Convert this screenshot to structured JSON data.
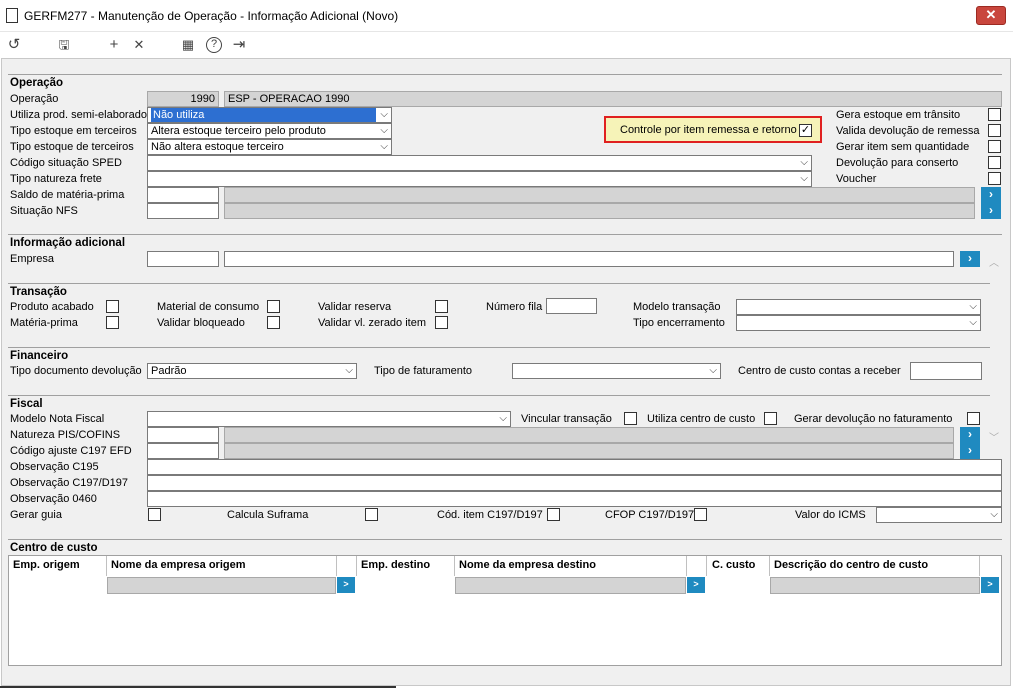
{
  "window": {
    "title": "GERFM277 - Manutenção de Operação - Informação Adicional (Novo)",
    "close_label": "✕"
  },
  "toolbar": {
    "undo": "↺",
    "save": "🖫",
    "add": "+",
    "remove": "✕",
    "calendar": "▦",
    "help": "?",
    "exit": "⇥"
  },
  "operacao": {
    "section": "Operação",
    "operacao_label": "Operação",
    "operacao_code": "1990",
    "operacao_desc": "ESP - OPERACAO 1990",
    "semi_label": "Utiliza prod. semi-elaborado",
    "semi_value": "Não utiliza",
    "tipo_estoque_label": "Tipo estoque em terceiros",
    "tipo_estoque_value": "Altera estoque terceiro pelo produto",
    "tipo_estoque_de_label": "Tipo estoque de terceiros",
    "tipo_estoque_de_value": "Não altera estoque terceiro",
    "sped_label": "Código situação SPED",
    "natureza_label": "Tipo natureza frete",
    "saldo_label": "Saldo de matéria-prima",
    "nfs_label": "Situação NFS",
    "controle_label": "Controle por item remessa e retorno",
    "gera_label": "Gera estoque em trânsito",
    "valida_label": "Valida devolução de remessa",
    "gerar_item_label": "Gerar item sem quantidade",
    "devolucao_label": "Devolução para conserto",
    "voucher_label": "Voucher"
  },
  "info": {
    "section": "Informação adicional",
    "empresa_label": "Empresa"
  },
  "transacao": {
    "section": "Transação",
    "produto_label": "Produto acabado",
    "materia_label": "Matéria-prima",
    "consumo_label": "Material de consumo",
    "bloqueado_label": "Validar bloqueado",
    "reserva_label": "Validar reserva",
    "zerado_label": "Validar vl. zerado item",
    "fila_label": "Número fila",
    "modelo_label": "Modelo transação",
    "encerramento_label": "Tipo encerramento"
  },
  "financeiro": {
    "section": "Financeiro",
    "tipo_doc_label": "Tipo documento devolução",
    "tipo_doc_value": "Padrão",
    "faturamento_label": "Tipo de faturamento",
    "centro_label": "Centro de custo contas a receber"
  },
  "fiscal": {
    "section": "Fiscal",
    "modelo_label": "Modelo Nota Fiscal",
    "vincular_label": "Vincular transação",
    "utiliza_label": "Utiliza centro de custo",
    "gerar_dev_label": "Gerar devolução no faturamento",
    "natureza_label": "Natureza PIS/COFINS",
    "ajuste_label": "Código ajuste C197 EFD",
    "obs_c195": "Observação C195",
    "obs_c197": "Observação C197/D197",
    "obs_0460": "Observação 0460",
    "guia_label": "Gerar guia",
    "suframa_label": "Calcula Suframa",
    "cod_item_label": "Cód. item C197/D197",
    "cfop_label": "CFOP C197/D197",
    "icms_label": "Valor do ICMS"
  },
  "centro": {
    "section": "Centro de custo",
    "columns": [
      "Emp. origem",
      "Nome da empresa origem",
      "Emp. destino",
      "Nome da empresa destino",
      "C. custo",
      "Descrição do centro de custo"
    ]
  },
  "colors": {
    "accent": "#1f8ac0",
    "highlight": "#f6f3b8",
    "highlight_border": "#e02020"
  }
}
